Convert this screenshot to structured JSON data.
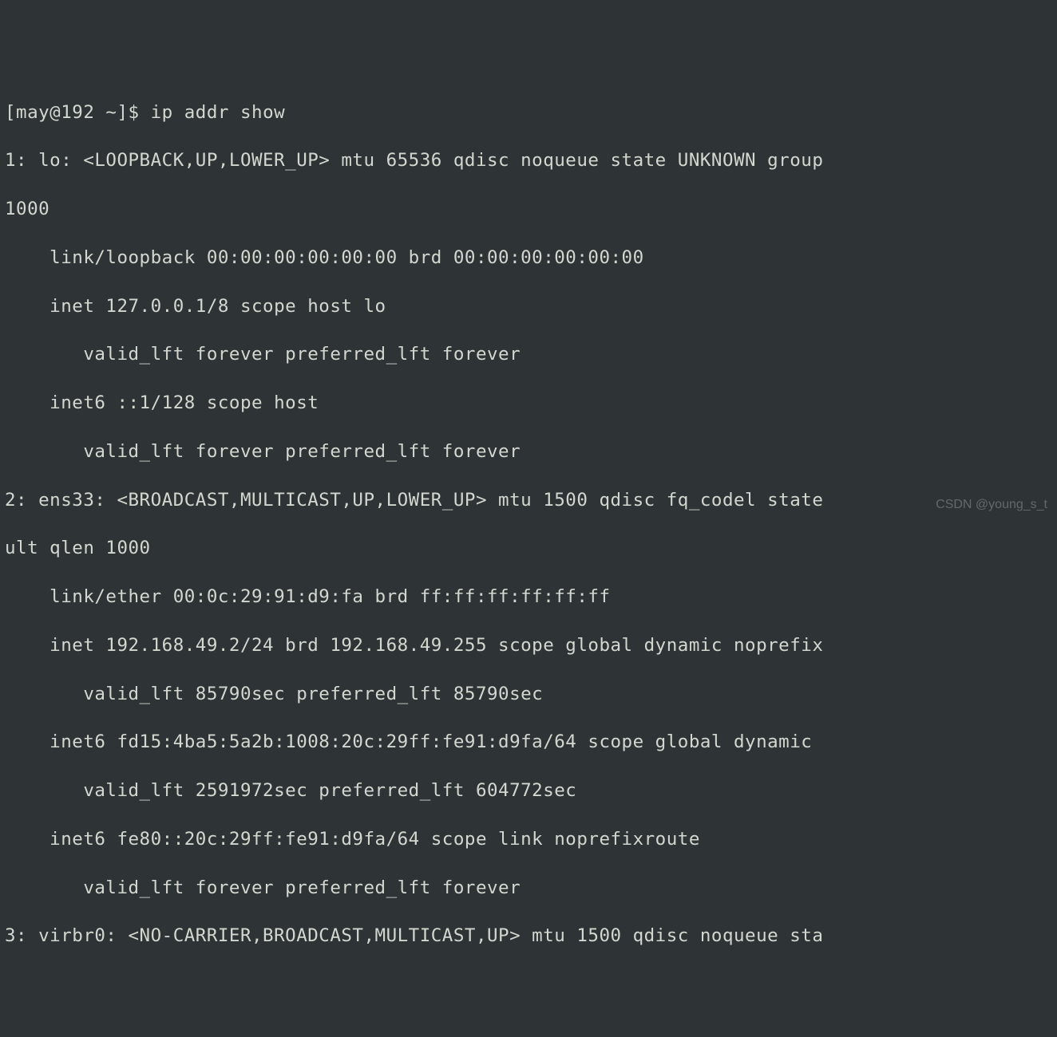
{
  "prompt": {
    "userhost": "[may@192 ~]$ ",
    "command": "ip addr show"
  },
  "lines": {
    "l1": "1: lo: <LOOPBACK,UP,LOWER_UP> mtu 65536 qdisc noqueue state UNKNOWN group",
    "l2": "1000",
    "l3": "    link/loopback 00:00:00:00:00:00 brd 00:00:00:00:00:00",
    "l4": "    inet 127.0.0.1/8 scope host lo",
    "l5": "       valid_lft forever preferred_lft forever",
    "l6": "    inet6 ::1/128 scope host",
    "l7": "       valid_lft forever preferred_lft forever",
    "l8": "2: ens33: <BROADCAST,MULTICAST,UP,LOWER_UP> mtu 1500 qdisc fq_codel state",
    "l9": "ult qlen 1000",
    "l10": "    link/ether 00:0c:29:91:d9:fa brd ff:ff:ff:ff:ff:ff",
    "l11": "    inet 192.168.49.2/24 brd 192.168.49.255 scope global dynamic noprefix",
    "l12": "       valid_lft 85790sec preferred_lft 85790sec",
    "l13": "    inet6 fd15:4ba5:5a2b:1008:20c:29ff:fe91:d9fa/64 scope global dynamic ",
    "l14": "       valid_lft 2591972sec preferred_lft 604772sec",
    "l15": "    inet6 fe80::20c:29ff:fe91:d9fa/64 scope link noprefixroute",
    "l16": "       valid_lft forever preferred_lft forever",
    "l17": "3: virbr0: <NO-CARRIER,BROADCAST,MULTICAST,UP> mtu 1500 qdisc noqueue sta"
  },
  "watermark": "CSDN @young_s_t"
}
